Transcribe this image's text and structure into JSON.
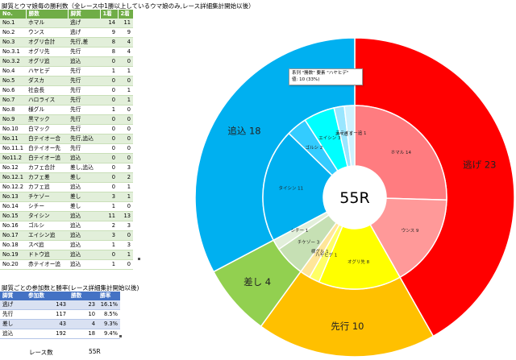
{
  "table1": {
    "title": "脚質とウマ娘毎の勝利数（全レース中1勝以上しているウマ娘のみ,レース詳細集計開始以後）",
    "headers": [
      "No.",
      "勝数",
      "脚質",
      "1着",
      "2着"
    ],
    "rows": [
      [
        "No.1",
        "ホマル",
        "逃げ",
        "14",
        "11"
      ],
      [
        "No.2",
        "ウンス",
        "逃げ",
        "9",
        "9"
      ],
      [
        "No.3",
        "オグリ合計",
        "先行,差",
        "8",
        "4"
      ],
      [
        "No.3.1",
        "オグリ先",
        "先行",
        "8",
        "4"
      ],
      [
        "No.3.2",
        "オグリ追",
        "追込",
        "0",
        "0"
      ],
      [
        "No.4",
        "ハヤヒデ",
        "先行",
        "1",
        "1"
      ],
      [
        "No.5",
        "ダスカ",
        "先行",
        "0",
        "0"
      ],
      [
        "No.6",
        "社会長",
        "先行",
        "0",
        "1"
      ],
      [
        "No.7",
        "ハロライス",
        "先行",
        "0",
        "1"
      ],
      [
        "No.8",
        "様グル",
        "先行",
        "1",
        "0"
      ],
      [
        "No.9",
        "黒マック",
        "先行",
        "0",
        "0"
      ],
      [
        "No.10",
        "白マック",
        "先行",
        "0",
        "0"
      ],
      [
        "No.11",
        "白テイオー合",
        "先行,追込",
        "0",
        "0"
      ],
      [
        "No.11.1",
        "白テイオー先",
        "先行",
        "0",
        "0"
      ],
      [
        "No11.2",
        "白テイオー追",
        "追込",
        "0",
        "0"
      ],
      [
        "No.12",
        "カフェ合計",
        "差し,追込",
        "0",
        "3"
      ],
      [
        "No.12.1",
        "カフェ差",
        "差し",
        "0",
        "2"
      ],
      [
        "No.12.2",
        "カフェ追",
        "追込",
        "0",
        "1"
      ],
      [
        "No.13",
        "チケゾー",
        "差し",
        "3",
        "1"
      ],
      [
        "No.14",
        "シチー",
        "差し",
        "1",
        "0"
      ],
      [
        "No.15",
        "タイシン",
        "追込",
        "11",
        "13"
      ],
      [
        "No.16",
        "ゴルシ",
        "追込",
        "2",
        "3"
      ],
      [
        "No.17",
        "エイシン追",
        "追込",
        "3",
        "0"
      ],
      [
        "No.18",
        "スペ追",
        "追込",
        "1",
        "3"
      ],
      [
        "No.19",
        "ドトウ追",
        "追込",
        "0",
        "1"
      ],
      [
        "No.20",
        "赤テイオー追",
        "追込",
        "1",
        "0"
      ]
    ]
  },
  "table2": {
    "title": "脚質ごとの参加数と勝率(レース詳細集計開始以後)",
    "headers": [
      "脚質",
      "参加数",
      "勝数",
      "勝率"
    ],
    "rows": [
      [
        "逃げ",
        "143",
        "23",
        "16.1%"
      ],
      [
        "先行",
        "117",
        "10",
        "8.5%"
      ],
      [
        "差し",
        "43",
        "4",
        "9.3%"
      ],
      [
        "追込",
        "192",
        "18",
        "9.4%"
      ]
    ]
  },
  "race_count": {
    "label": "レース数",
    "value": "55R"
  },
  "tooltip": {
    "line1": "系列 \"勝数\" 要素 \"ハヤヒデ\"",
    "line2": "値: 10 (33%)"
  },
  "chart_data": {
    "type": "pie",
    "center_label": "55R",
    "outer_ring": [
      {
        "label": "逃げ 23",
        "value": 23,
        "color": "#ff0000"
      },
      {
        "label": "先行 10",
        "value": 10,
        "color": "#ffc000"
      },
      {
        "label": "差し 4",
        "value": 4,
        "color": "#92d050"
      },
      {
        "label": "追込 18",
        "value": 18,
        "color": "#00b0f0"
      }
    ],
    "inner_ring": [
      {
        "label": "ホマル 14",
        "value": 14,
        "color": "#ff7c80"
      },
      {
        "label": "ウンス 9",
        "value": 9,
        "color": "#ff9999"
      },
      {
        "label": "オグリ先 8",
        "value": 8,
        "color": "#ffff00"
      },
      {
        "label": "ハヤヒデ 1",
        "value": 1,
        "color": "#ffff66"
      },
      {
        "label": "様グル 1",
        "value": 1,
        "color": "#ffe699"
      },
      {
        "label": "チケゾー 3",
        "value": 3,
        "color": "#c6e0b4"
      },
      {
        "label": "シチー 1",
        "value": 1,
        "color": "#e2efda"
      },
      {
        "label": "タイシン 11",
        "value": 11,
        "color": "#00b0f0"
      },
      {
        "label": "ゴルシ 2",
        "value": 2,
        "color": "#33ccff"
      },
      {
        "label": "エイシン 3",
        "value": 3,
        "color": "#00ffff"
      },
      {
        "label": "スペ追 1",
        "value": 1,
        "color": "#99e6ff"
      },
      {
        "label": "赤テイオー追 1",
        "value": 1,
        "color": "#ccf2ff"
      }
    ]
  }
}
